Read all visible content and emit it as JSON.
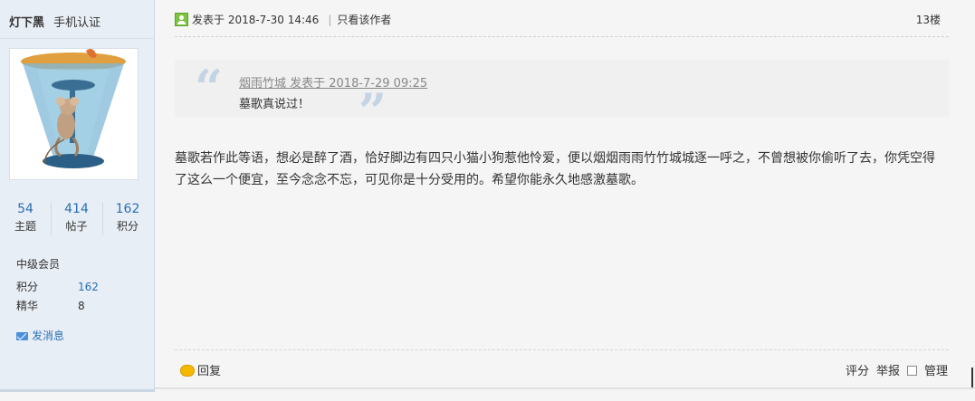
{
  "author": {
    "name": "灯下黑",
    "verification": "手机认证",
    "stats": [
      {
        "value": "54",
        "label": "主题"
      },
      {
        "value": "414",
        "label": "帖子"
      },
      {
        "value": "162",
        "label": "积分"
      }
    ],
    "level": "中级会员",
    "points_label": "积分",
    "points_value": "162",
    "essence_label": "精华",
    "essence_value": "8",
    "message_label": "发消息"
  },
  "post": {
    "posted_label": "发表于 2018-7-30 14:46",
    "author_only_label": "只看该作者",
    "floor": "13楼",
    "quote": {
      "author_time": "烟雨竹城 发表于 2018-7-29 09:25",
      "text": "墓歌真说过！"
    },
    "body": "墓歌若作此等语，想必是醉了酒，恰好脚边有四只小猫小狗惹他怜爱，便以烟烟雨雨竹竹城城逐一呼之，不曾想被你偷听了去，你凭空得了这么一个便宜，至今念念不忘，可见你是十分受用的。希望你能永久地感激墓歌。",
    "reply_label": "回复",
    "rate_label": "评分",
    "report_label": "举报",
    "manage_label": "管理"
  }
}
